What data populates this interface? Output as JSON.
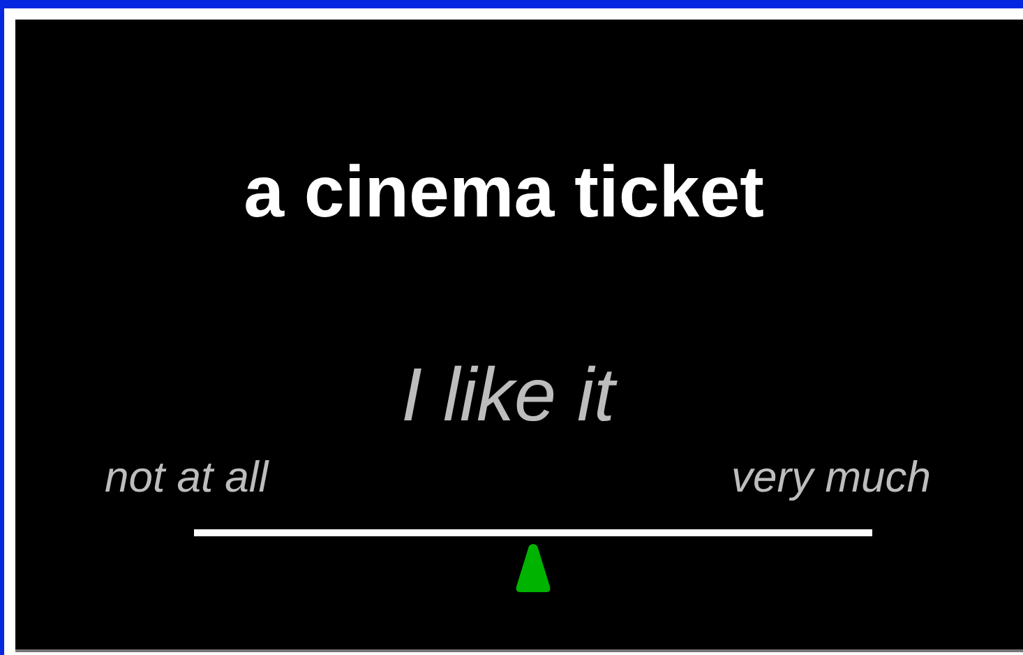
{
  "stimulus": "a cinema ticket",
  "question": "I like it",
  "scale": {
    "left_label": "not at all",
    "right_label": "very much",
    "level": 0.5
  }
}
